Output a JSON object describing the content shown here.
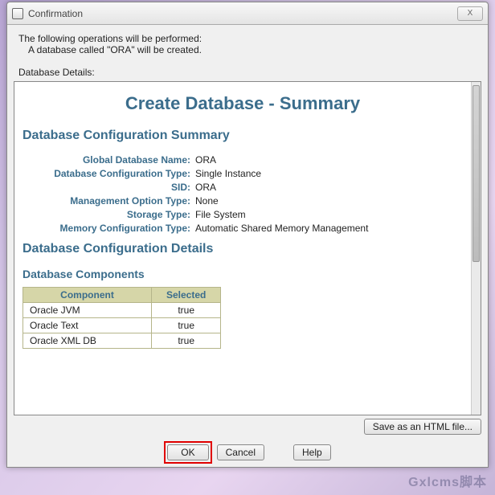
{
  "window": {
    "title": "Confirmation",
    "close": "X"
  },
  "message": {
    "line1": "The following operations will be performed:",
    "line2": "A database called \"ORA\" will be created.",
    "details_label": "Database Details:"
  },
  "summary": {
    "title": "Create Database - Summary",
    "section1": "Database Configuration Summary",
    "kv": {
      "global_db_name_k": "Global Database Name:",
      "global_db_name_v": "ORA",
      "config_type_k": "Database Configuration Type:",
      "config_type_v": "Single Instance",
      "sid_k": "SID:",
      "sid_v": "ORA",
      "mgmt_k": "Management Option Type:",
      "mgmt_v": "None",
      "storage_k": "Storage Type:",
      "storage_v": "File System",
      "mem_k": "Memory Configuration Type:",
      "mem_v": "Automatic Shared Memory Management"
    },
    "section2": "Database Configuration Details",
    "components_heading": "Database Components",
    "table": {
      "col_component": "Component",
      "col_selected": "Selected",
      "rows": [
        {
          "name": "Oracle JVM",
          "selected": "true"
        },
        {
          "name": "Oracle Text",
          "selected": "true"
        },
        {
          "name": "Oracle XML DB",
          "selected": "true"
        }
      ]
    }
  },
  "buttons": {
    "save": "Save as an HTML file...",
    "ok": "OK",
    "cancel": "Cancel",
    "help": "Help"
  },
  "watermark": "Gxlcms脚本"
}
